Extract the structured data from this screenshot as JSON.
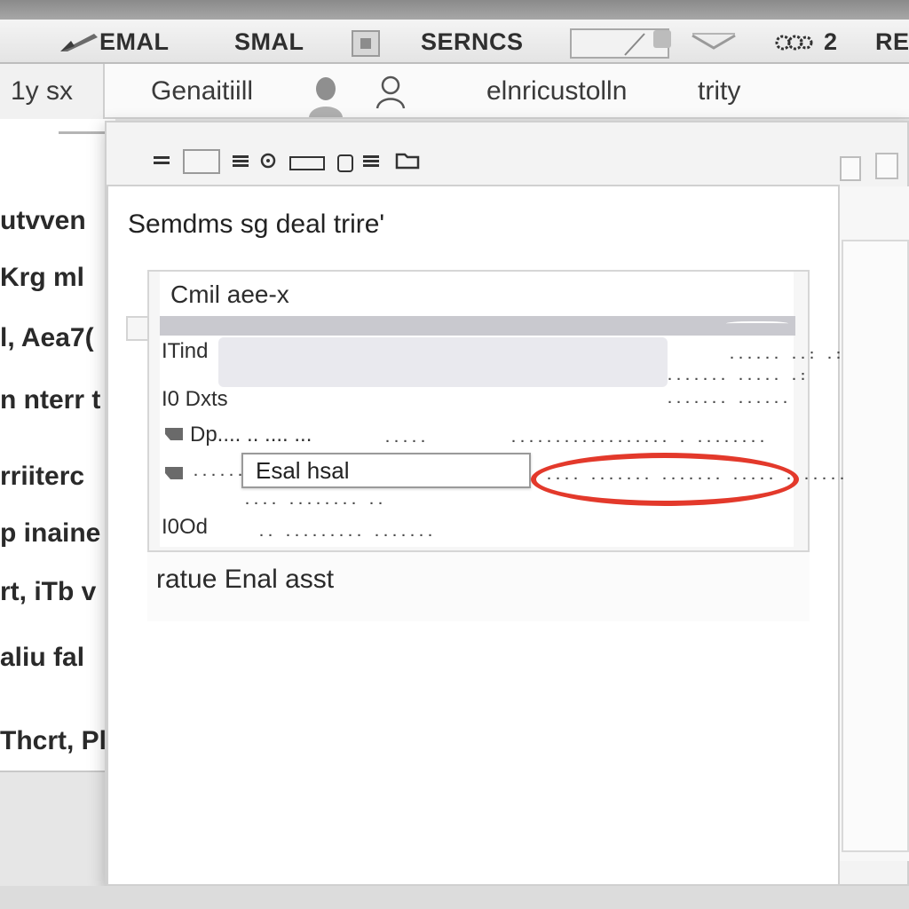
{
  "menubar": {
    "items": [
      "EMAL",
      "SMAL",
      "SERNCS",
      "2",
      "RE"
    ]
  },
  "subbar": {
    "items": [
      "1y sx",
      "Genaitiill",
      "elnricustolln",
      "trity"
    ]
  },
  "background_list": {
    "items": [
      "utvven",
      "Krg  ml",
      "l, Aea7(",
      "n nterr  t",
      "rriiterc",
      "p inaine",
      "rt, iTb  v",
      "aliu fal",
      "Thcrt, Pl"
    ]
  },
  "dialog": {
    "title": "Semdms sg deal trire'",
    "card": {
      "header": "Cmil aee-x",
      "rows": [
        {
          "label": "ITind",
          "values": [
            "...... ..: .:",
            "....... ..... .:"
          ]
        },
        {
          "label": "I0 Dxts",
          "values": [
            "....... ......"
          ]
        },
        {
          "label": "Dp.... .. .... ...",
          "values": [
            ".....",
            ".................. . ........"
          ]
        },
        {
          "label": "...... ..",
          "values": [
            ".... .......   ....... ..... .......",
            ".... ........ .."
          ]
        },
        {
          "label": "I0Od",
          "values": [
            ".. ......... ......."
          ]
        }
      ],
      "email_input_value": "Esal hsal"
    },
    "footer": "ratue Enal asst"
  },
  "colors": {
    "highlight_oval": "#e3392b",
    "menubar_bg": "#eeeeee",
    "header_rule": "#c9c9cf"
  },
  "icons": [
    "pen-icon",
    "square-icon",
    "slash-icon",
    "chevron-icon",
    "bell-icon",
    "avatar-icon",
    "person-icon",
    "menu-icon",
    "folder-icon",
    "tag-icon"
  ]
}
